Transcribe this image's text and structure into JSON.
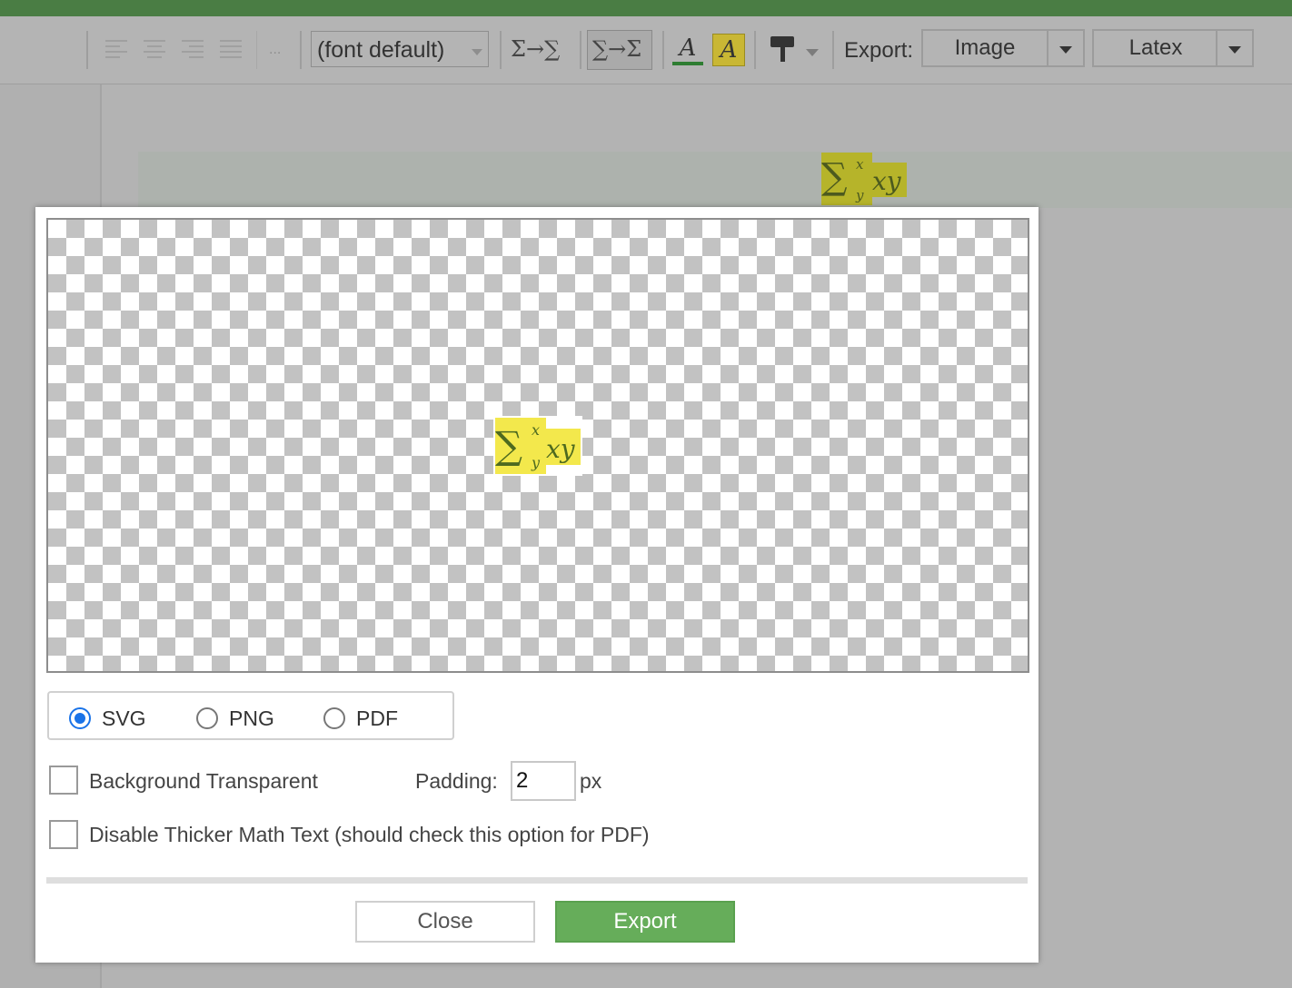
{
  "toolbar": {
    "more_label": "...",
    "font_select_value": "(font default)",
    "sum_style_inline_label": "Σ→∑",
    "sum_style_display_label": "∑→Σ",
    "font_color_glyph": "A",
    "highlight_glyph": "A",
    "export_label": "Export:",
    "export_image_label": "Image",
    "export_latex_label": "Latex",
    "font_color_hex": "#2e7d32",
    "highlight_hex": "#c9b734"
  },
  "document": {
    "math_sum": "∑",
    "math_sup": "x",
    "math_sub": "y",
    "math_body": "xy"
  },
  "dialog": {
    "preview_math": {
      "sum": "∑",
      "sup": "x",
      "sub": "y",
      "body": "xy"
    },
    "formats": [
      {
        "label": "SVG",
        "checked": true
      },
      {
        "label": "PNG",
        "checked": false
      },
      {
        "label": "PDF",
        "checked": false
      }
    ],
    "background_transparent_label": "Background Transparent",
    "background_transparent_checked": false,
    "padding_label": "Padding:",
    "padding_value": "2",
    "padding_unit": "px",
    "disable_thicker_label": "Disable Thicker Math Text (should check this option for PDF)",
    "disable_thicker_checked": false,
    "close_label": "Close",
    "export_label": "Export",
    "export_button_color": "#66ad5a"
  }
}
